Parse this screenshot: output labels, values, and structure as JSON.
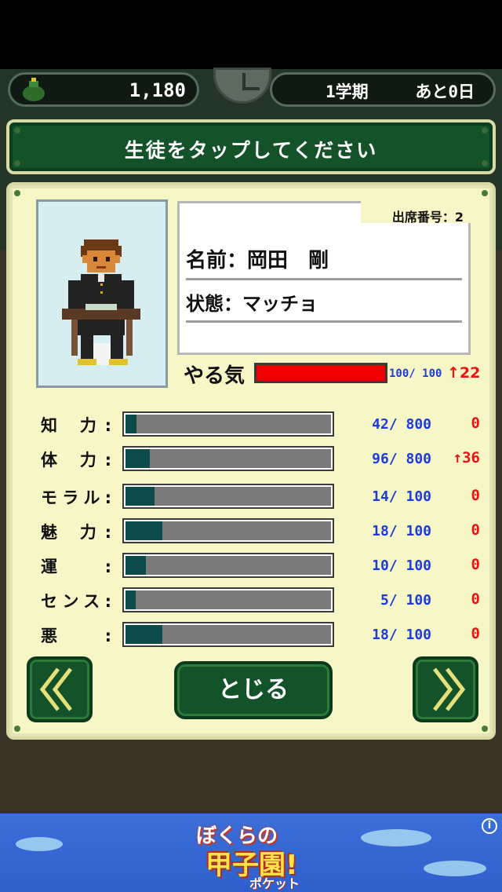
{
  "hud": {
    "money": "1,180",
    "semester": "1学期",
    "days_left": "あと0日"
  },
  "instruction": "生徒をタップしてください",
  "student": {
    "attendance_number": "出席番号：2",
    "name": "名前：岡田　剛",
    "status": "状態：マッチョ"
  },
  "motivation": {
    "label": "やる気",
    "value_text": "100/ 100",
    "value": 100,
    "max": 100,
    "delta": "↑22"
  },
  "stats": [
    {
      "label": "知 力:",
      "value_text": "42/ 800",
      "value": 42,
      "max": 800,
      "delta": "0"
    },
    {
      "label": "体 力:",
      "value_text": "96/ 800",
      "value": 96,
      "max": 800,
      "delta": "↑36"
    },
    {
      "label": "モラル:",
      "value_text": "14/ 100",
      "value": 14,
      "max": 100,
      "delta": "0"
    },
    {
      "label": "魅 力:",
      "value_text": "18/ 100",
      "value": 18,
      "max": 100,
      "delta": "0"
    },
    {
      "label": "運 :",
      "value_text": "10/ 100",
      "value": 10,
      "max": 100,
      "delta": "0"
    },
    {
      "label": "センス:",
      "value_text": "5/ 100",
      "value": 5,
      "max": 100,
      "delta": "0"
    },
    {
      "label": "悪 :",
      "value_text": "18/ 100",
      "value": 18,
      "max": 100,
      "delta": "0"
    }
  ],
  "buttons": {
    "prev": "《",
    "close": "とじる",
    "next": "》"
  },
  "ad": {
    "line1": "ぼくらの",
    "line2": "甲子園!",
    "line3": "ポケット",
    "info": "i"
  },
  "colors": {
    "panel_bg": "#f7f6c6",
    "button_green": "#14532a",
    "motivation_bar": "#ee0000",
    "stat_bar": "#0d4a4a",
    "value_blue": "#1c3bd8",
    "delta_red": "#e11111"
  },
  "icons": {
    "money": "money-bag-icon",
    "clock": "clock-icon",
    "prev": "double-chevron-left-icon",
    "next": "double-chevron-right-icon",
    "info": "info-icon"
  }
}
